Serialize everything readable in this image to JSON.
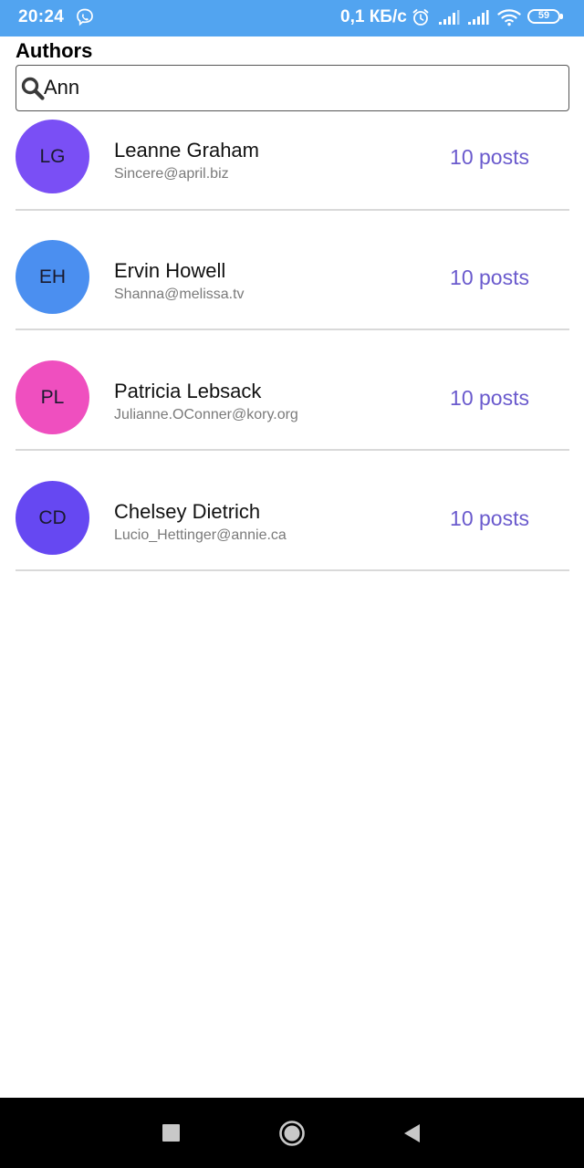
{
  "status_bar": {
    "time": "20:24",
    "net_speed": "0,1 КБ/с",
    "battery_level": "59",
    "background_color": "#52a4f0"
  },
  "page": {
    "title": "Authors"
  },
  "search": {
    "value": "Ann",
    "icon": "search-icon"
  },
  "authors": [
    {
      "initials": "LG",
      "name": "Leanne Graham",
      "email": "Sincere@april.biz",
      "posts": "10 posts",
      "avatar_color": "#7a4ff5"
    },
    {
      "initials": "EH",
      "name": "Ervin Howell",
      "email": "Shanna@melissa.tv",
      "posts": "10 posts",
      "avatar_color": "#4b8ff0"
    },
    {
      "initials": "PL",
      "name": "Patricia Lebsack",
      "email": "Julianne.OConner@kory.org",
      "posts": "10 posts",
      "avatar_color": "#ef4fbf"
    },
    {
      "initials": "CD",
      "name": "Chelsey Dietrich",
      "email": "Lucio_Hettinger@annie.ca",
      "posts": "10 posts",
      "avatar_color": "#6648f2"
    }
  ],
  "colors": {
    "accent": "#6a5acd",
    "divider": "#d9d9d9",
    "nav_background": "#000000"
  },
  "nav_bar": {
    "recents_icon": "square-icon",
    "home_icon": "circle-home-icon",
    "back_icon": "triangle-back-icon"
  }
}
